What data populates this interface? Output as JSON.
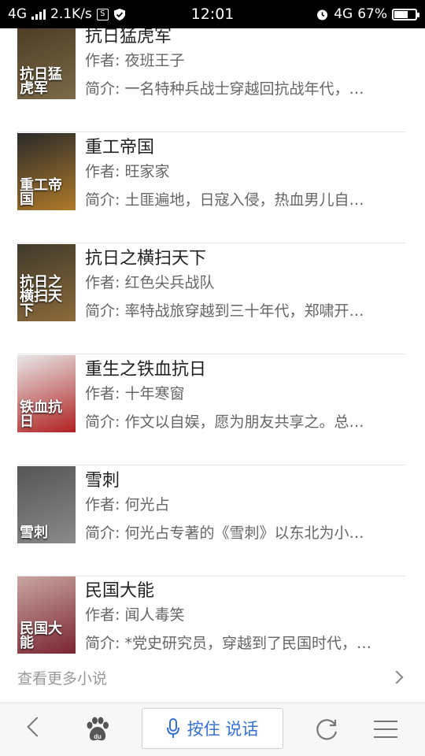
{
  "status_bar": {
    "network": "4G",
    "speed": "2.1K/s",
    "time": "12:01",
    "network_right": "4G",
    "battery_percent": "67%",
    "battery_level": 0.67,
    "notification_badge": "S"
  },
  "books": [
    {
      "title": "抗日猛虎军",
      "author": "作者: 夜班王子",
      "intro": "简介: 一名特种兵战士穿越回抗战年代，…",
      "cover_text": "抗日猛虎军",
      "cover_colors": [
        "#4a3a22",
        "#7b6a48"
      ]
    },
    {
      "title": "重工帝国",
      "author": "作者: 旺家家",
      "intro": "简介: 土匪遍地，日寇入侵，热血男儿自…",
      "cover_text": "重工帝国",
      "cover_colors": [
        "#2a2a2a",
        "#b07a2a"
      ]
    },
    {
      "title": "抗日之横扫天下",
      "author": "作者: 红色尖兵战队",
      "intro": "简介: 率特战旅穿越到三十年代，郑啸开…",
      "cover_text": "抗日之横扫天下",
      "cover_colors": [
        "#3f3a2b",
        "#8c6a3a"
      ]
    },
    {
      "title": "重生之铁血抗日",
      "author": "作者: 十年寒窗",
      "intro": "简介: 作文以自娱，愿为朋友共享之。总…",
      "cover_text": "铁血抗日",
      "cover_colors": [
        "#e8e8e8",
        "#b02020"
      ]
    },
    {
      "title": "雪刺",
      "author": "作者: 何光占",
      "intro": "简介: 何光占专著的《雪刺》以东北为小…",
      "cover_text": "雪刺",
      "cover_colors": [
        "#555555",
        "#8a8a8a"
      ]
    },
    {
      "title": "民国大能",
      "author": "作者: 闻人毒笑",
      "intro": "简介: *党史研究员，穿越到了民国时代，…",
      "cover_text": "民国大能",
      "cover_colors": [
        "#c9a6a2",
        "#7a2430"
      ]
    }
  ],
  "more_link": "查看更多小说",
  "bottom_bar": {
    "voice_label": "按住 说话",
    "accent_color": "#3470d6"
  }
}
